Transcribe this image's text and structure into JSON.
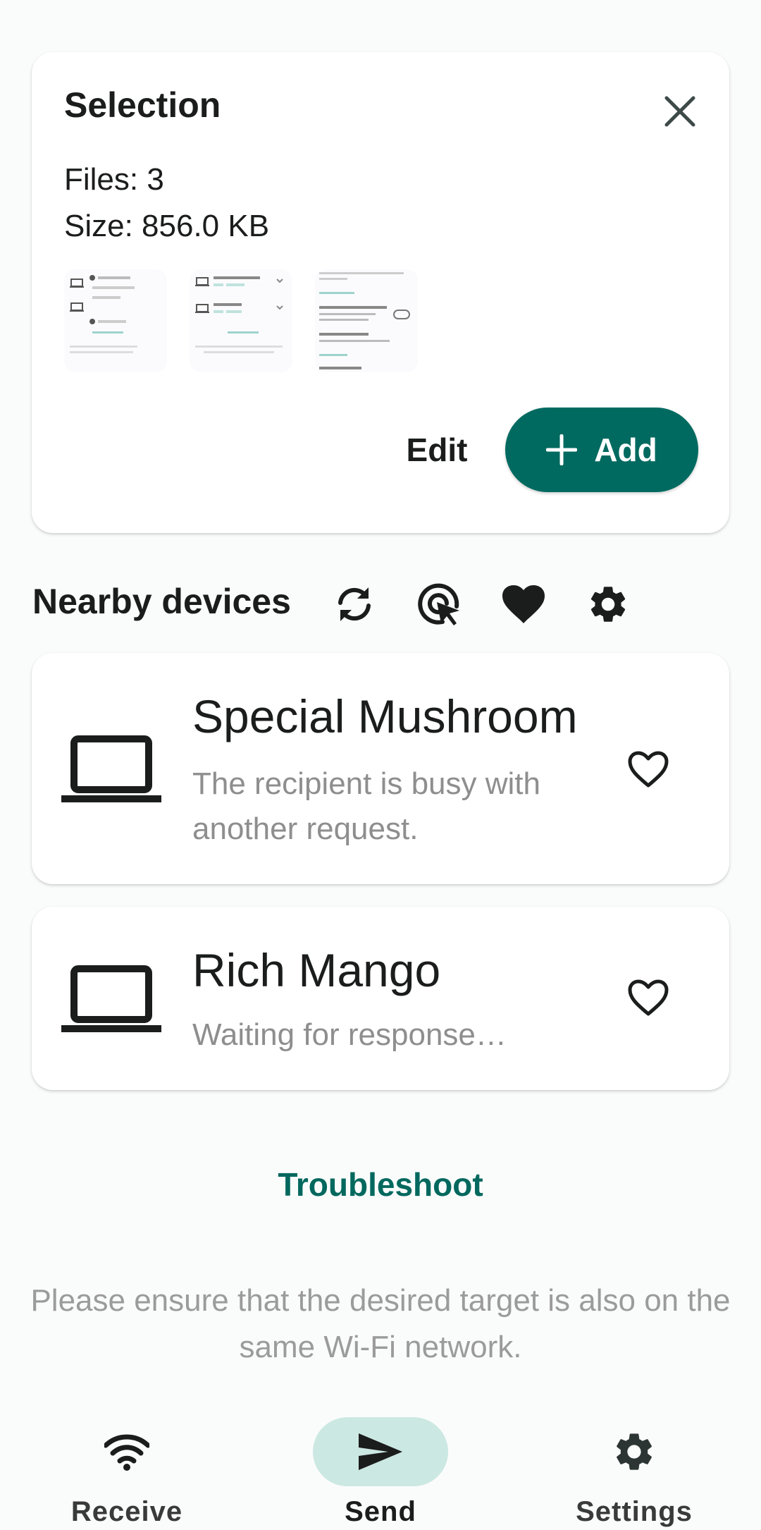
{
  "selection": {
    "title": "Selection",
    "files_label": "Files: 3",
    "size_label": "Size: 856.0 KB",
    "thumbnails": [
      "thumbnail-1",
      "thumbnail-2",
      "thumbnail-3"
    ],
    "edit_label": "Edit",
    "add_label": "Add",
    "close_icon": "close-icon"
  },
  "nearby": {
    "title": "Nearby devices",
    "icons": [
      "refresh-icon",
      "target-cursor-icon",
      "heart-filled-icon",
      "gear-icon"
    ]
  },
  "devices": [
    {
      "name": "Special Mushroom",
      "status": "The recipient is busy with another request.",
      "icon": "laptop-icon",
      "favorite_icon": "heart-outline-icon"
    },
    {
      "name": "Rich Mango",
      "status": "Waiting for response…",
      "icon": "laptop-icon",
      "favorite_icon": "heart-outline-icon"
    }
  ],
  "troubleshoot_label": "Troubleshoot",
  "hint": "Please ensure that the desired target is also on the same Wi-Fi network.",
  "bottom_nav": [
    {
      "label": "Receive",
      "icon": "wifi-icon",
      "active": false
    },
    {
      "label": "Send",
      "icon": "send-icon",
      "active": true
    },
    {
      "label": "Settings",
      "icon": "gear-icon",
      "active": false
    }
  ],
  "colors": {
    "accent": "#006a60",
    "accent_text": "#00685e",
    "nav_active_pill": "#cce8e3",
    "status_text": "#8e8e8e",
    "hint_text": "#9b9b9b",
    "background": "#fafcfb"
  }
}
